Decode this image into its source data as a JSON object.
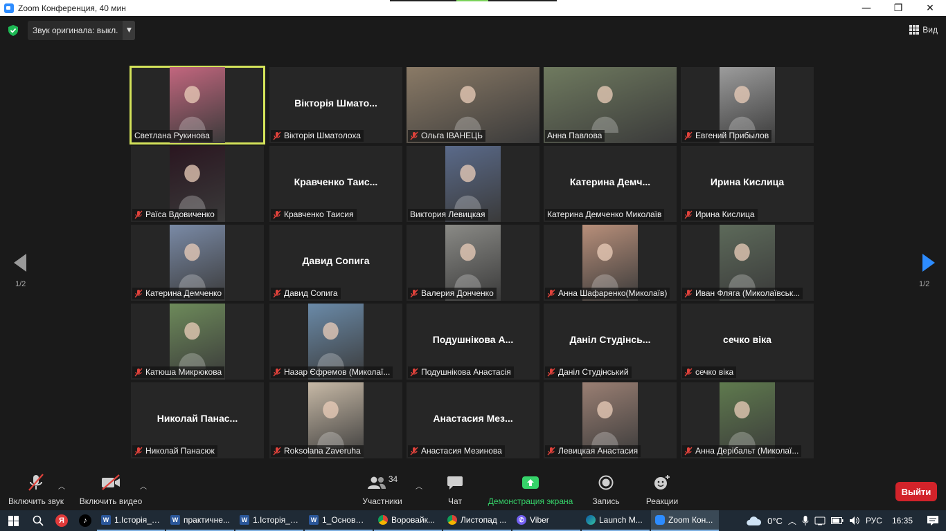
{
  "window": {
    "title": "Zoom Конференция, 40 мин",
    "minimize": "—",
    "restore": "❐",
    "close": "✕"
  },
  "topbar": {
    "audio_label": "Звук оригинала: выкл.",
    "view_label": "Вид"
  },
  "pagination": {
    "left": "1/2",
    "right": "1/2"
  },
  "participants": [
    {
      "tag": "Светлана Рукинова",
      "big": "",
      "muted": false,
      "active": true,
      "photo": "#c2667e"
    },
    {
      "tag": "Вікторія Шматолоха",
      "big": "Вікторія Шмато...",
      "muted": true
    },
    {
      "tag": "Ольга ІВАНЕЦЬ",
      "big": "",
      "muted": true,
      "photo": "#8a7a66"
    },
    {
      "tag": "Анна Павлова",
      "big": "",
      "muted": false,
      "photo": "#6f7a5f"
    },
    {
      "tag": "Евгений Прибылов",
      "big": "",
      "muted": true,
      "photo": "#9c9c9c"
    },
    {
      "tag": "Раїса Вдовиченко",
      "big": "",
      "muted": true,
      "photo": "#2a1620"
    },
    {
      "tag": "Кравченко Таисия",
      "big": "Кравченко Таис...",
      "muted": true
    },
    {
      "tag": "Виктория Левицкая",
      "big": "",
      "muted": false,
      "photo": "#5a6a8a"
    },
    {
      "tag": "Катерина Демченко Миколаїв",
      "big": "Катерина Демч...",
      "muted": false
    },
    {
      "tag": "Ирина Кислица",
      "big": "Ирина Кислица",
      "muted": true
    },
    {
      "tag": "Катерина Демченко",
      "big": "",
      "muted": true,
      "photo": "#7a8aa6"
    },
    {
      "tag": "Давид Сопига",
      "big": "Давид Сопига",
      "muted": true
    },
    {
      "tag": "Валерия Донченко",
      "big": "",
      "muted": true,
      "photo": "#8a8a86"
    },
    {
      "tag": "Анна Шафаренко(Миколаїв)",
      "big": "",
      "muted": true,
      "photo": "#b88f7a"
    },
    {
      "tag": "Иван Фляга (Миколаївськ...",
      "big": "",
      "muted": true,
      "photo": "#5d6a5a"
    },
    {
      "tag": "Катюша Микрюкова",
      "big": "",
      "muted": true,
      "photo": "#6d8a5a"
    },
    {
      "tag": "Назар Єфремов (Миколаї...",
      "big": "",
      "muted": true,
      "photo": "#6a8aa8"
    },
    {
      "tag": "Подушнікова Анастасія",
      "big": "Подушнікова А...",
      "muted": true
    },
    {
      "tag": "Даніл Студінський",
      "big": "Даніл Студінсь...",
      "muted": true
    },
    {
      "tag": "сечко віка",
      "big": "сечко віка",
      "muted": true
    },
    {
      "tag": "Николай Панасюк",
      "big": "Николай Панас...",
      "muted": true
    },
    {
      "tag": "Roksolana Zaveruha",
      "big": "",
      "muted": true,
      "photo": "#c7b9a6"
    },
    {
      "tag": "Анастасия Мезинова",
      "big": "Анастасия Мез...",
      "muted": true
    },
    {
      "tag": "Левицкая Анастасия",
      "big": "",
      "muted": true,
      "photo": "#9a7f73"
    },
    {
      "tag": "Анна Дерібальт (Миколаї...",
      "big": "",
      "muted": true,
      "photo": "#5f7a4e"
    }
  ],
  "toolbar": {
    "unmute": "Включить звук",
    "start_video": "Включить видео",
    "participants": "Участники",
    "participants_count": "34",
    "chat": "Чат",
    "share": "Демонстрация экрана",
    "record": "Запись",
    "reactions": "Реакции",
    "leave": "Выйти"
  },
  "taskbar": {
    "apps": [
      {
        "label": "1.Історія_с...",
        "type": "word",
        "active": false
      },
      {
        "label": "практичне...",
        "type": "word",
        "active": false
      },
      {
        "label": "1.Історія_с...",
        "type": "word",
        "active": false
      },
      {
        "label": "1_Основи ...",
        "type": "word",
        "active": false
      },
      {
        "label": "Воровайк...",
        "type": "chrome",
        "active": false
      },
      {
        "label": "Листопад ...",
        "type": "chrome",
        "active": false
      },
      {
        "label": "Viber",
        "type": "viber",
        "active": false
      },
      {
        "label": "Launch M...",
        "type": "edge",
        "active": false
      },
      {
        "label": "Zoom Кон...",
        "type": "zoom",
        "active": true
      }
    ],
    "temperature": "0°C",
    "language": "РУС",
    "time": "16:35"
  },
  "colors": {
    "accent_green": "#36d36a",
    "active_speaker": "#d4e35a",
    "leave_red": "#d2232a",
    "muted_red": "#e0423b"
  }
}
